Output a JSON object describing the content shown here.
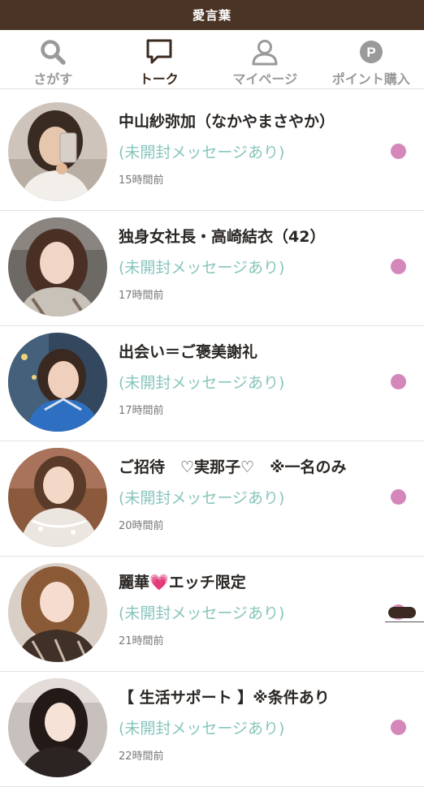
{
  "app": {
    "title": "愛言葉"
  },
  "tabs": [
    {
      "label": "さがす",
      "icon": "search-icon"
    },
    {
      "label": "トーク",
      "icon": "chat-bubble-icon"
    },
    {
      "label": "マイページ",
      "icon": "user-icon"
    },
    {
      "label": "ポイント購入",
      "icon": "points-icon"
    }
  ],
  "active_tab": "トーク",
  "colors": {
    "header": "#4a3425",
    "status_text": "#87c5bd",
    "unread_dot": "#d586ba",
    "active_tab": "#3b2a1f",
    "inactive_tab": "#9a9a9a"
  },
  "conversations": [
    {
      "name": "中山紗弥加（なかやまさやか）",
      "status": "(未開封メッセージあり)",
      "time": "15時間前"
    },
    {
      "name": "独身女社長・高崎結衣（42）",
      "status": "(未開封メッセージあり)",
      "time": "17時間前"
    },
    {
      "name": "出会い＝ご褒美謝礼",
      "status": "(未開封メッセージあり)",
      "time": "17時間前"
    },
    {
      "name": "ご招待　♡実那子♡　※一名のみ",
      "status": "(未開封メッセージあり)",
      "time": "20時間前"
    },
    {
      "name_prefix": "麗華",
      "name_emoji": "💗",
      "name_suffix": "エッチ限定",
      "status": "(未開封メッセージあり)",
      "time": "21時間前"
    },
    {
      "name": "【 生活サポート 】※条件あり",
      "status": "(未開封メッセージあり)",
      "time": "22時間前"
    }
  ]
}
